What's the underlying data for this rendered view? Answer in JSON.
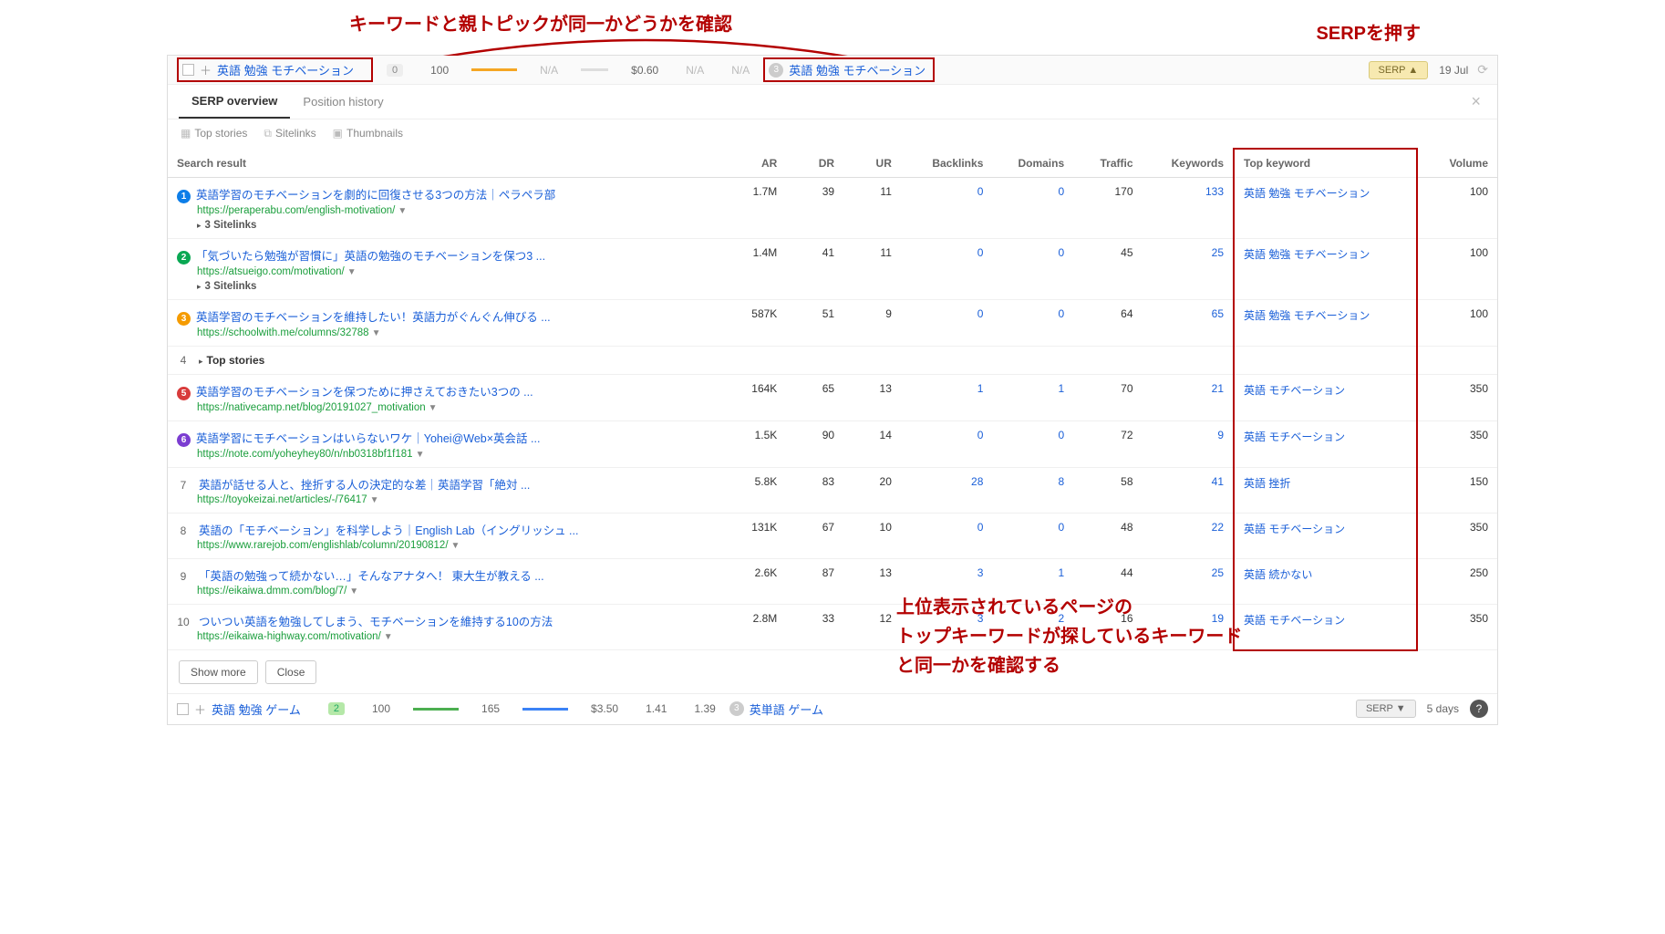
{
  "callouts": {
    "top": "キーワードと親トピックが同一かどうかを確認",
    "serp": "SERPを押す",
    "bottom": "上位表示されているページの\nトップキーワードが探しているキーワード\nと同一かを確認する"
  },
  "headRow": {
    "keyword": "英語 勉強 モチベーション",
    "badge": "0",
    "kd": "100",
    "na1": "N/A",
    "cpc": "$0.60",
    "na2": "N/A",
    "na3": "N/A",
    "circleNum": "3",
    "parent": "英語 勉強 モチベーション",
    "serpBtn": "SERP ▲",
    "date": "19 Jul"
  },
  "tabs": {
    "overview": "SERP overview",
    "history": "Position history"
  },
  "features": {
    "top": "Top stories",
    "sitelinks": "Sitelinks",
    "thumbs": "Thumbnails"
  },
  "columns": {
    "search": "Search result",
    "ar": "AR",
    "dr": "DR",
    "ur": "UR",
    "bl": "Backlinks",
    "dom": "Domains",
    "traffic": "Traffic",
    "kw": "Keywords",
    "tk": "Top keyword",
    "vol": "Volume"
  },
  "rows": [
    {
      "pos": "1",
      "badge": "b1",
      "title": "英語学習のモチベーションを劇的に回復させる3つの方法｜ペラペラ部",
      "url": "https://peraperabu.com/english-motivation/",
      "expand": "3 Sitelinks",
      "ar": "1.7M",
      "dr": "39",
      "ur": "11",
      "bl": "0",
      "dom": "0",
      "traffic": "170",
      "kw": "133",
      "tk": "英語 勉強 モチベーション",
      "vol": "100"
    },
    {
      "pos": "2",
      "badge": "b2",
      "title": "「気づいたら勉強が習慣に」英語の勉強のモチベーションを保つ3 ...",
      "url": "https://atsueigo.com/motivation/",
      "expand": "3 Sitelinks",
      "ar": "1.4M",
      "dr": "41",
      "ur": "11",
      "bl": "0",
      "dom": "0",
      "traffic": "45",
      "kw": "25",
      "tk": "英語 勉強 モチベーション",
      "vol": "100"
    },
    {
      "pos": "3",
      "badge": "b3",
      "title": "英語学習のモチベーションを維持したい！英語力がぐんぐん伸びる ...",
      "url": "https://schoolwith.me/columns/32788",
      "ar": "587K",
      "dr": "51",
      "ur": "9",
      "bl": "0",
      "dom": "0",
      "traffic": "64",
      "kw": "65",
      "tk": "英語 勉強 モチベーション",
      "vol": "100"
    },
    {
      "pos": "4",
      "topstories": "Top stories"
    },
    {
      "pos": "5",
      "badge": "b5",
      "title": "英語学習のモチベーションを保つために押さえておきたい3つの ...",
      "url": "https://nativecamp.net/blog/20191027_motivation",
      "ar": "164K",
      "dr": "65",
      "ur": "13",
      "bl": "1",
      "dom": "1",
      "traffic": "70",
      "kw": "21",
      "tk": "英語 モチベーション",
      "vol": "350"
    },
    {
      "pos": "6",
      "badge": "b6",
      "title": "英語学習にモチベーションはいらないワケ｜Yohei@Web×英会話 ...",
      "url": "https://note.com/yoheyhey80/n/nb0318bf1f181",
      "ar": "1.5K",
      "dr": "90",
      "ur": "14",
      "bl": "0",
      "dom": "0",
      "traffic": "72",
      "kw": "9",
      "tk": "英語 モチベーション",
      "vol": "350"
    },
    {
      "pos": "7",
      "title": "英語が話せる人と、挫折する人の決定的な差｜英語学習「絶対 ...",
      "url": "https://toyokeizai.net/articles/-/76417",
      "ar": "5.8K",
      "dr": "83",
      "ur": "20",
      "bl": "28",
      "dom": "8",
      "traffic": "58",
      "kw": "41",
      "tk": "英語 挫折",
      "vol": "150"
    },
    {
      "pos": "8",
      "title": "英語の「モチベーション」を科学しよう｜English Lab（イングリッシュ ...",
      "url": "https://www.rarejob.com/englishlab/column/20190812/",
      "ar": "131K",
      "dr": "67",
      "ur": "10",
      "bl": "0",
      "dom": "0",
      "traffic": "48",
      "kw": "22",
      "tk": "英語 モチベーション",
      "vol": "350"
    },
    {
      "pos": "9",
      "title": "「英語の勉強って続かない…」そんなアナタへ！ 東大生が教える ...",
      "url": "https://eikaiwa.dmm.com/blog/7/",
      "ar": "2.6K",
      "dr": "87",
      "ur": "13",
      "bl": "3",
      "dom": "1",
      "traffic": "44",
      "kw": "25",
      "tk": "英語 続かない",
      "vol": "250"
    },
    {
      "pos": "10",
      "title": "ついつい英語を勉強してしまう、モチベーションを維持する10の方法",
      "url": "https://eikaiwa-highway.com/motivation/",
      "ar": "2.8M",
      "dr": "33",
      "ur": "12",
      "bl": "3",
      "dom": "2",
      "traffic": "16",
      "kw": "19",
      "tk": "英語 モチベーション",
      "vol": "350"
    }
  ],
  "buttons": {
    "showMore": "Show more",
    "close": "Close"
  },
  "bottomRow": {
    "keyword": "英語 勉強 ゲーム",
    "badge": "2",
    "kd": "100",
    "vol": "165",
    "cpc": "$3.50",
    "v1": "1.41",
    "v2": "1.39",
    "circleNum": "3",
    "parent": "英単語 ゲーム",
    "serpBtn": "SERP ▼",
    "date": "5 days"
  }
}
